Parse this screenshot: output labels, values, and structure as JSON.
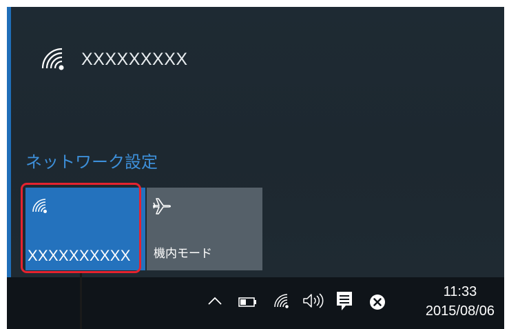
{
  "network": {
    "ssid": "XXXXXXXXX",
    "icon": "wifi-icon"
  },
  "settings_link": "ネットワーク設定",
  "quick_actions": [
    {
      "label": "XXXXXXXXXX",
      "icon": "wifi-icon",
      "active": true
    },
    {
      "label": "機内モード",
      "icon": "airplane-icon",
      "active": false
    }
  ],
  "taskbar": {
    "tray_icons": [
      "chevron-up-icon",
      "battery-icon",
      "wifi-icon",
      "speaker-icon",
      "action-center-icon",
      "error-icon"
    ],
    "time": "11:33",
    "date": "2015/08/06"
  },
  "colors": {
    "flyout_bg": "#1e2a33",
    "accent": "#1f6eb8",
    "link": "#3d8fd9",
    "tile_active": "#2472bd",
    "tile_inactive": "#556069",
    "highlight": "#e5232f",
    "taskbar_bg": "#0f1419"
  }
}
